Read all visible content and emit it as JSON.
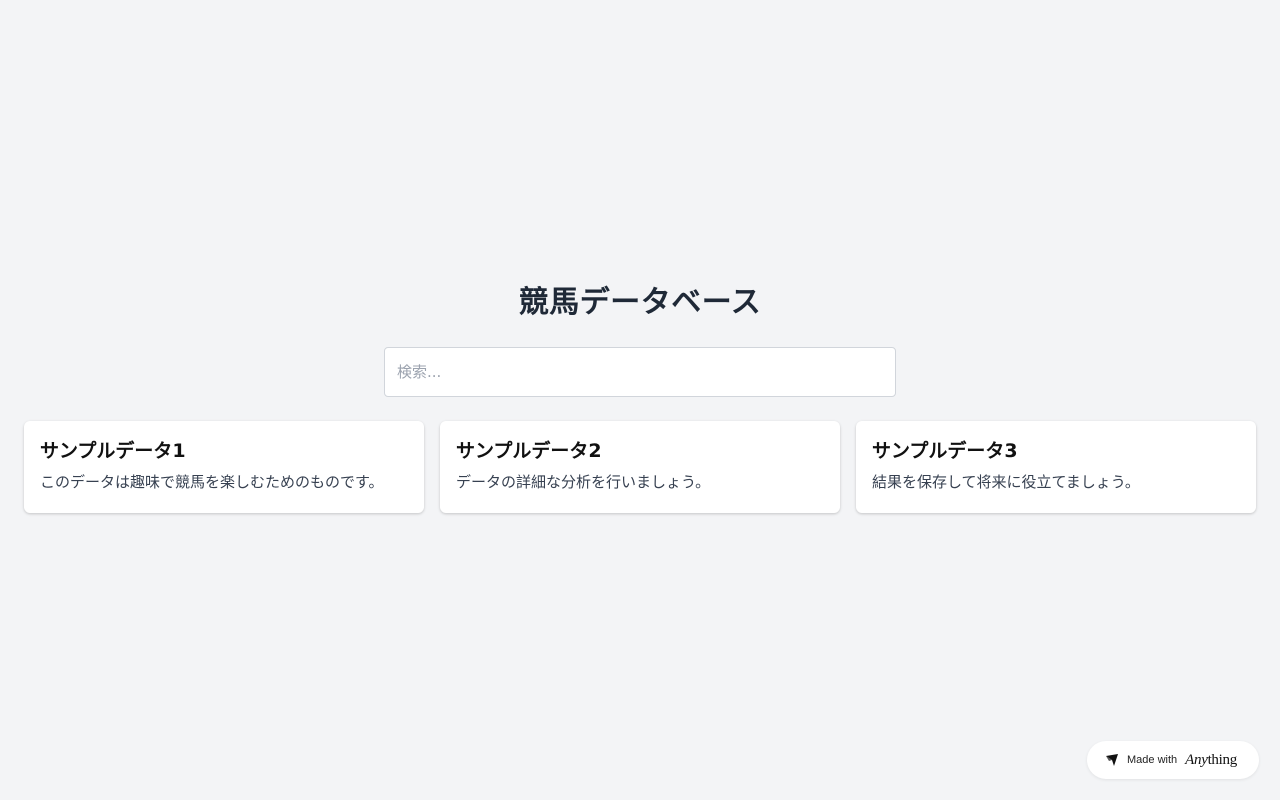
{
  "header": {
    "title": "競馬データベース"
  },
  "search": {
    "placeholder": "検索..."
  },
  "cards": [
    {
      "title": "サンプルデータ1",
      "description": "このデータは趣味で競馬を楽しむためのものです。"
    },
    {
      "title": "サンプルデータ2",
      "description": "データの詳細な分析を行いましょう。"
    },
    {
      "title": "サンプルデータ3",
      "description": "結果を保存して将来に役立てましょう。"
    }
  ],
  "badge": {
    "made_with": "Made with",
    "brand_italic": "Any",
    "brand_rest": "thing",
    "icon": "anything-logo-icon"
  }
}
